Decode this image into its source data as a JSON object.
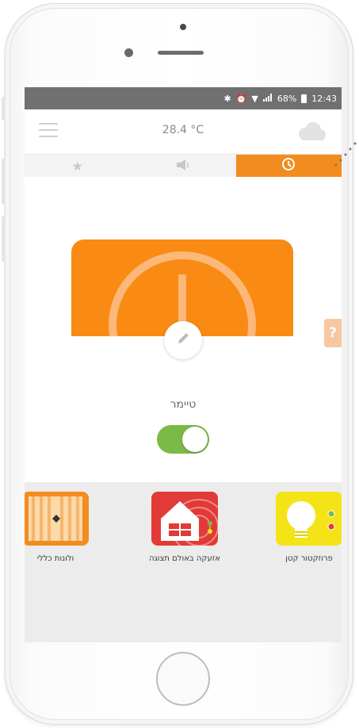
{
  "status_bar": {
    "icons": [
      "bluetooth-icon",
      "alarm-icon",
      "wifi-icon",
      "signal-icon"
    ],
    "battery": "68%",
    "time": "12:43"
  },
  "header": {
    "temperature": "28.4 °C",
    "weather_icon": "cloud-icon"
  },
  "tabs": [
    {
      "icon": "star-icon",
      "active": false
    },
    {
      "icon": "speaker-icon",
      "active": false
    },
    {
      "icon": "clock-icon",
      "active": true
    }
  ],
  "timer": {
    "label": "טיימר",
    "enabled": true,
    "help": "?"
  },
  "devices": [
    {
      "label": "ולונות כללי",
      "icon": "blinds-icon"
    },
    {
      "label": "אזעקה באולם תצוגה",
      "icon": "house-alarm-icon"
    },
    {
      "label": "פרוזקטור קטן",
      "icon": "bulb-icon"
    }
  ],
  "colors": {
    "accent": "#f38c1f",
    "toggle_on": "#7cba47",
    "status_bar": "#707070",
    "alarm_red": "#e23a36",
    "bulb_yellow": "#f4e417"
  }
}
